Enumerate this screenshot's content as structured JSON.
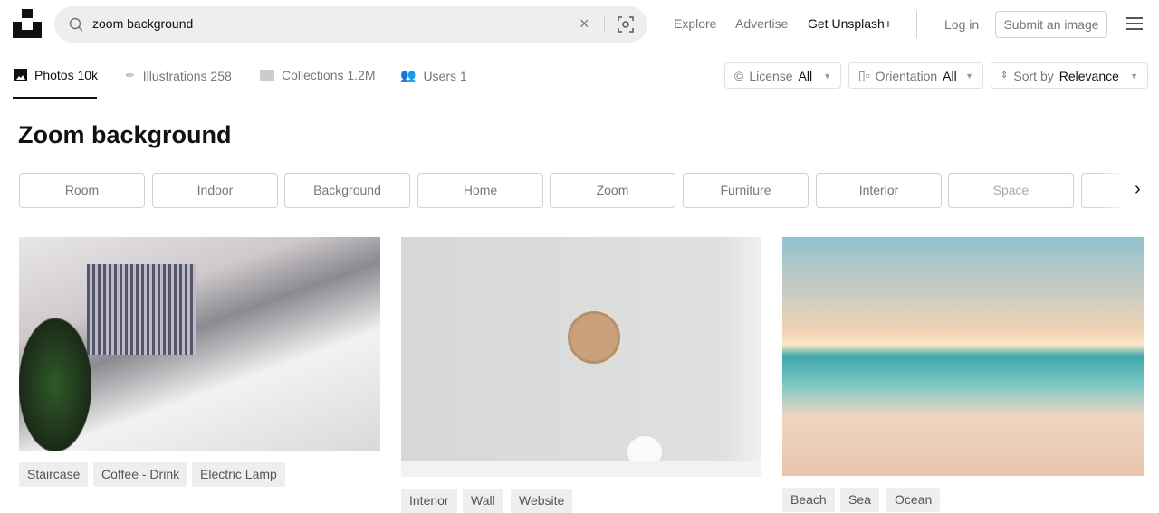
{
  "header": {
    "search_value": "zoom background",
    "nav": [
      "Explore",
      "Advertise",
      "Get Unsplash+"
    ],
    "login": "Log in",
    "submit": "Submit an image"
  },
  "tabs": [
    {
      "label": "Photos 10k",
      "icon": "image-icon"
    },
    {
      "label": "Illustrations 258",
      "icon": "pen-icon"
    },
    {
      "label": "Collections 1.2M",
      "icon": "folder-icon"
    },
    {
      "label": "Users 1",
      "icon": "users-icon"
    }
  ],
  "filters": {
    "license": {
      "label": "License",
      "value": "All"
    },
    "orientation": {
      "label": "Orientation",
      "value": "All"
    },
    "sort": {
      "label": "Sort by",
      "value": "Relevance"
    }
  },
  "title": "Zoom background",
  "chips": [
    "Room",
    "Indoor",
    "Background",
    "Home",
    "Zoom",
    "Furniture",
    "Interior",
    "Space"
  ],
  "photos": [
    {
      "tags": [
        "Staircase",
        "Coffee - Drink",
        "Electric Lamp"
      ]
    },
    {
      "tags": [
        "Interior",
        "Wall",
        "Website"
      ]
    },
    {
      "tags": [
        "Beach",
        "Sea",
        "Ocean"
      ]
    }
  ]
}
